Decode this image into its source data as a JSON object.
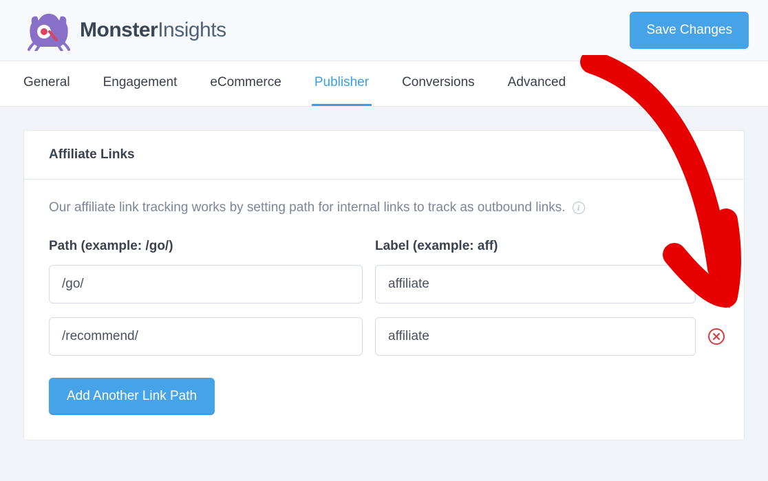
{
  "header": {
    "brand_bold": "Monster",
    "brand_light": "Insights",
    "save_button": "Save Changes"
  },
  "tabs": [
    {
      "label": "General",
      "active": false
    },
    {
      "label": "Engagement",
      "active": false
    },
    {
      "label": "eCommerce",
      "active": false
    },
    {
      "label": "Publisher",
      "active": true
    },
    {
      "label": "Conversions",
      "active": false
    },
    {
      "label": "Advanced",
      "active": false
    }
  ],
  "section": {
    "title": "Affiliate Links",
    "description": "Our affiliate link tracking works by setting path for internal links to track as outbound links.",
    "path_column_label": "Path (example: /go/)",
    "label_column_label": "Label (example: aff)",
    "rows": [
      {
        "path": "/go/",
        "label": "affiliate"
      },
      {
        "path": "/recommend/",
        "label": "affiliate"
      }
    ],
    "add_button": "Add Another Link Path"
  }
}
